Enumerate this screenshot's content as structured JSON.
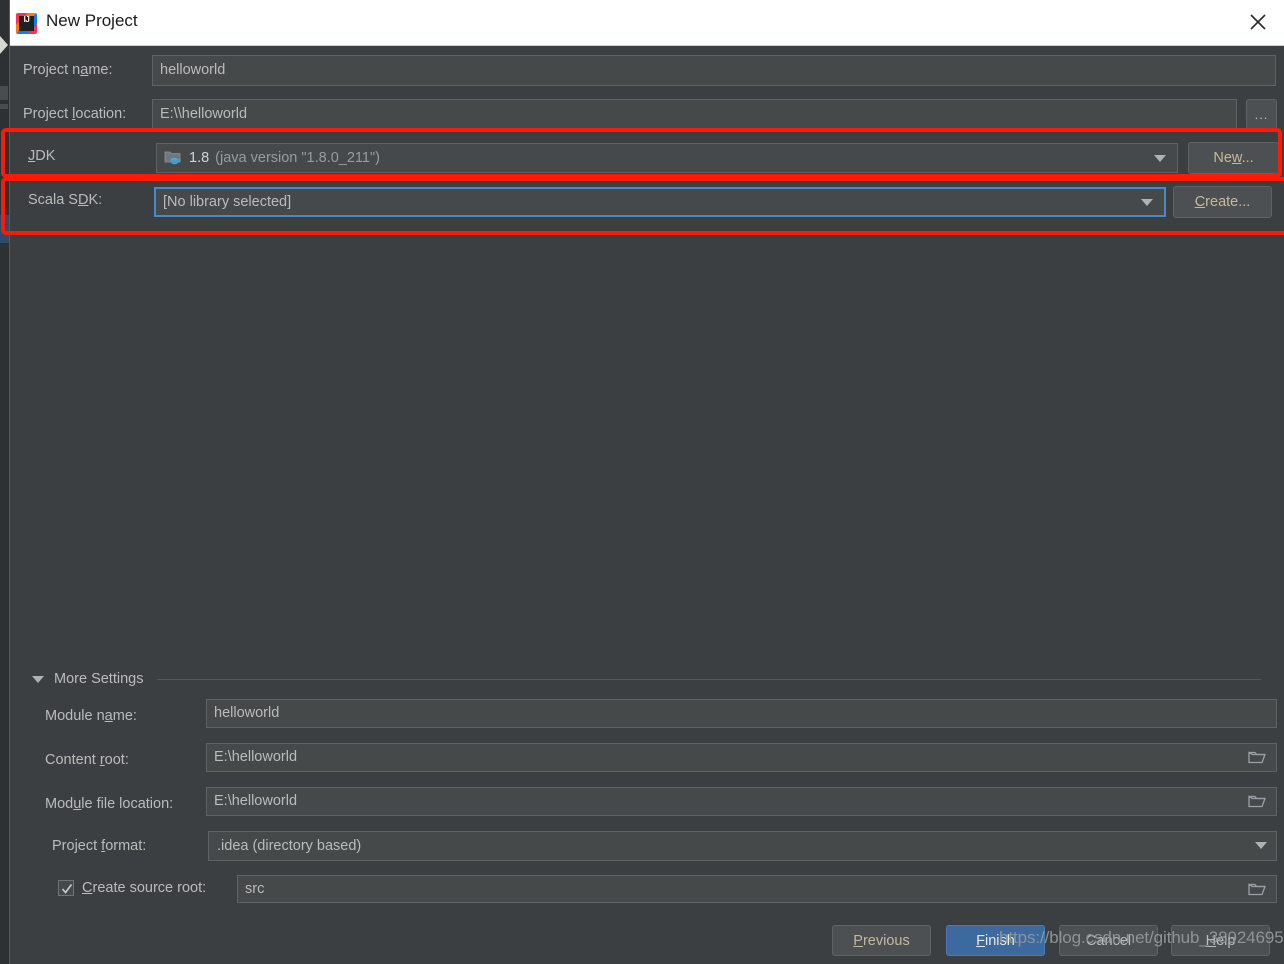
{
  "window": {
    "title": "New Project",
    "logo_icon": "intellij-idea-logo",
    "close_icon": "close-icon"
  },
  "form": {
    "project_name": {
      "label": "Project name:",
      "value": "helloworld"
    },
    "project_location": {
      "label": "Project location:",
      "value": "E:\\\\helloworld",
      "browse_label": "..."
    },
    "jdk": {
      "label": "JDK",
      "value_main": "1.8",
      "value_detail": "(java version \"1.8.0_211\")",
      "icon": "java-sdk-icon",
      "button_label": "New..."
    },
    "scala_sdk": {
      "label": "Scala SDK:",
      "value": "[No library selected]",
      "button_label": "Create..."
    }
  },
  "more_settings": {
    "label": "More Settings",
    "expanded": true,
    "module_name": {
      "label": "Module name:",
      "value": "helloworld"
    },
    "content_root": {
      "label": "Content root:",
      "value": "E:\\helloworld"
    },
    "module_file_location": {
      "label": "Module file location:",
      "value": "E:\\helloworld"
    },
    "project_format": {
      "label": "Project format:",
      "value": ".idea (directory based)"
    },
    "create_source_root": {
      "label": "Create source root:",
      "checked": true,
      "value": "src"
    }
  },
  "footer": {
    "previous": "Previous",
    "finish": "Finish",
    "cancel": "Cancel",
    "help": "Help"
  },
  "watermark": {
    "text": "https://blog.csdn.net/github_38924695"
  },
  "colors": {
    "dialog_bg": "#3c3f41",
    "field_bg": "#45494a",
    "accent_focus": "#4a88c7",
    "primary_button": "#3c6a9e",
    "annotation_red": "#ff1a08",
    "label_text": "#bbbbbb",
    "titlebar_bg": "#ffffff"
  }
}
